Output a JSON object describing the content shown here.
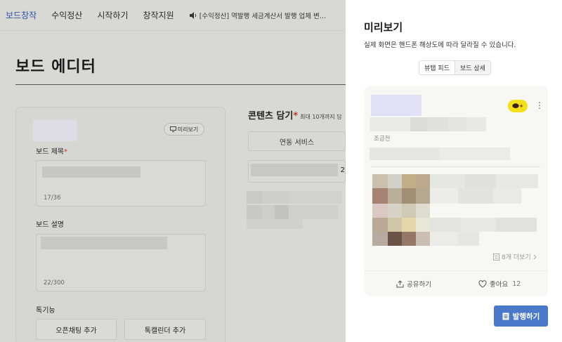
{
  "topnav": {
    "items": [
      "보드창작",
      "수익정산",
      "시작하기",
      "창작지원"
    ],
    "notice": "[수익정산] 역발행 세금계산서 발행 업체 변…"
  },
  "editor": {
    "page_title": "보드 에디터",
    "preview_button": "미리보기",
    "board_title_label": "보드 제목",
    "board_title_counter": "17/36",
    "board_desc_label": "보드 설명",
    "board_desc_counter": "22/300",
    "features_label": "톡기능",
    "open_chat_button": "오픈채팅 추가",
    "talk_calendar_button": "톡캘린더 추가",
    "content_heading": "콘텐츠 담기",
    "content_hint": "최대 10개까지 담",
    "linked_service_button": "연동 서비스",
    "field_right_char": "2"
  },
  "preview": {
    "title": "미리보기",
    "subtitle": "실제 화면은 핸드폰 해상도에 따라 달라질 수 있습니다.",
    "tabs": [
      "뷰탭 피드",
      "보드 상세"
    ],
    "active_tab": 0,
    "author_name": "조금전",
    "more_link": "8개 더보기",
    "share_label": "공유하기",
    "like_label": "좋아요",
    "like_count": "12",
    "badge_text": "+",
    "publish_button": "발행하기"
  },
  "colors": {
    "brand_active": "#2d55a7",
    "publish_blue": "#4a79c9",
    "kakao_yellow": "#f7e01a",
    "required_red": "#c0392b"
  }
}
